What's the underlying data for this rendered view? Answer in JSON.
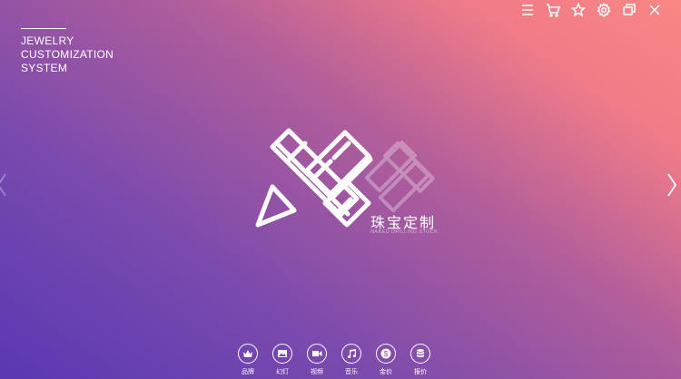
{
  "brand": {
    "lines": [
      "JEWELRY",
      "CUSTOMIZATION",
      "SYSTEM"
    ]
  },
  "toolbar": {
    "icons": [
      "menu-icon",
      "cart-icon",
      "star-icon",
      "gear-icon",
      "restore-icon",
      "close-icon"
    ]
  },
  "logo": {
    "title": "珠宝定制",
    "subtitle": "NAKED DRILLING STOCK"
  },
  "nav": {
    "items": [
      {
        "label": "品牌",
        "icon": "crown-icon"
      },
      {
        "label": "幻灯",
        "icon": "image-icon"
      },
      {
        "label": "视频",
        "icon": "video-icon"
      },
      {
        "label": "音乐",
        "icon": "music-icon"
      },
      {
        "label": "金价",
        "icon": "dollar-icon"
      },
      {
        "label": "报价",
        "icon": "coins-icon"
      }
    ]
  },
  "colors": {
    "gradient_start": "#5a38b2",
    "gradient_end": "#f98784"
  }
}
